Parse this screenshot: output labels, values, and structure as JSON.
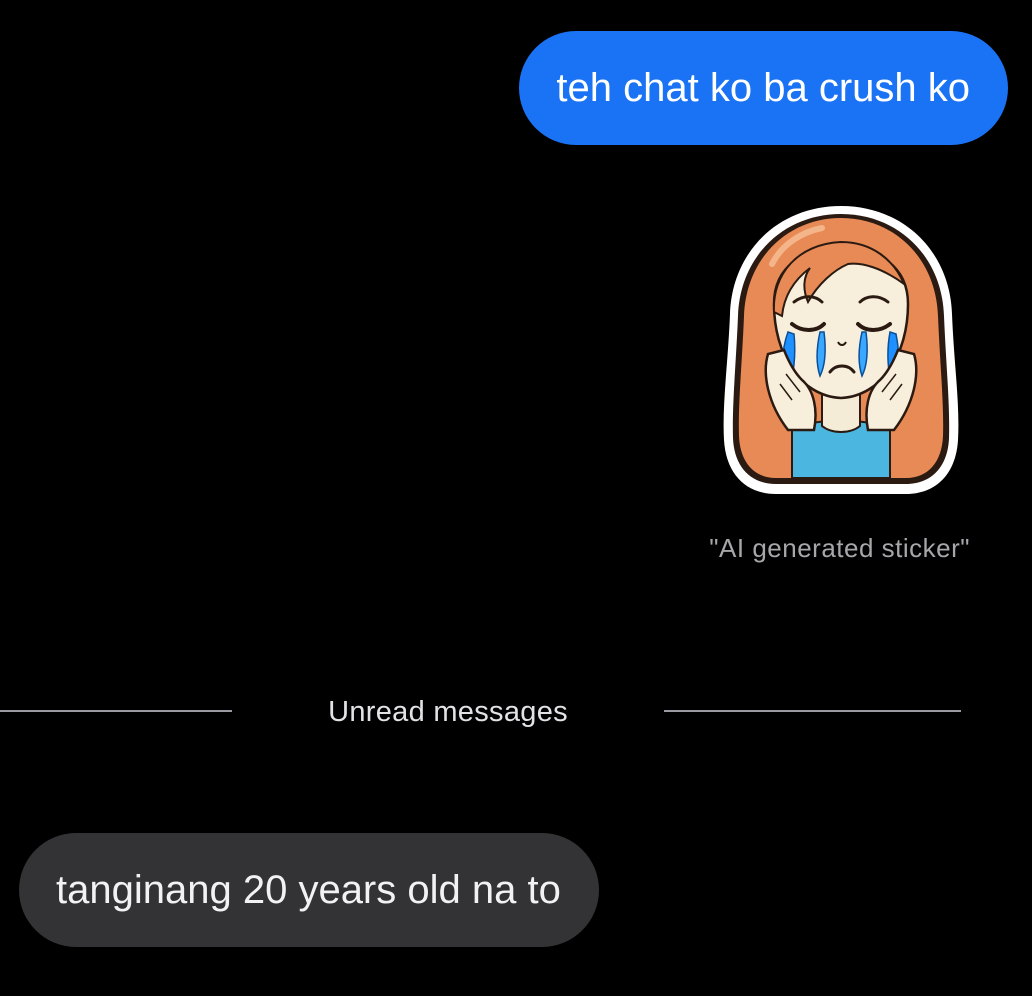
{
  "messages": {
    "outgoing": {
      "text": "teh chat ko ba crush ko"
    },
    "sticker": {
      "icon": "crying-girl-sticker-icon",
      "caption": "\"AI generated sticker\""
    },
    "incoming": {
      "text": "tanginang 20 years old na to"
    }
  },
  "divider": {
    "label": "Unread messages"
  },
  "colors": {
    "background": "#000000",
    "outgoing_bubble": "#1a73f5",
    "incoming_bubble": "#333335",
    "caption_text": "#a7a7ab"
  }
}
